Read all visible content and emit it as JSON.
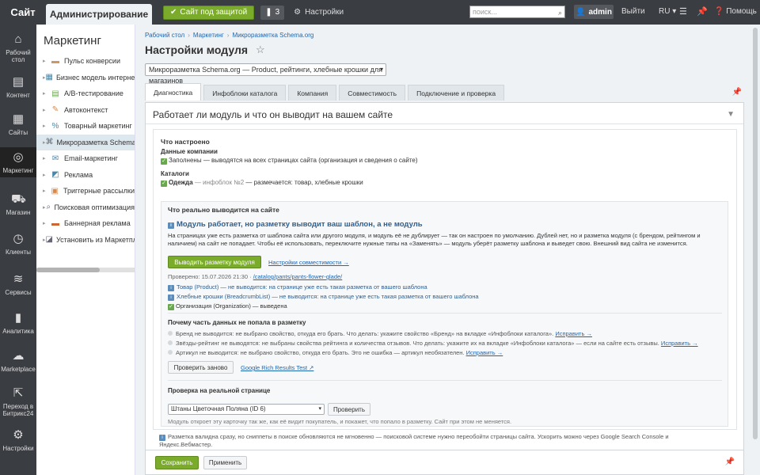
{
  "topbar": {
    "site_tab": "Сайт",
    "admin_tab": "Администрирование",
    "protect_label": "Сайт под защитой",
    "notif_count": "3",
    "settings_label": "Настройки",
    "search_placeholder": "поиск...",
    "user": "admin",
    "logout": "Выйти",
    "lang": "RU",
    "help": "Помощь"
  },
  "rail": [
    {
      "label": "Рабочий стол",
      "icon": "home-icon"
    },
    {
      "label": "Контент",
      "icon": "document-icon"
    },
    {
      "label": "Сайты",
      "icon": "calendar-icon"
    },
    {
      "label": "Маркетинг",
      "icon": "target-icon"
    },
    {
      "label": "Магазин",
      "icon": "cart-icon"
    },
    {
      "label": "Клиенты",
      "icon": "clock-icon"
    },
    {
      "label": "Сервисы",
      "icon": "layers-icon"
    },
    {
      "label": "Аналитика",
      "icon": "bar-chart-icon"
    },
    {
      "label": "Marketplace",
      "icon": "cloud-download-icon"
    },
    {
      "label": "Переход в Битрикс24",
      "icon": "arrow-out-icon"
    },
    {
      "label": "Настройки",
      "icon": "gear-icon"
    }
  ],
  "menu": {
    "title": "Маркетинг",
    "items": [
      "Пульс конверсии",
      "Бизнес модель интернет-м",
      "A/B-тестирование",
      "Автоконтекст",
      "Товарный маркетинг",
      "Микроразметка Schema.or",
      "Email-маркетинг",
      "Реклама",
      "Триггерные рассылки",
      "Поисковая оптимизация",
      "Баннерная реклама",
      "Установить из Маркетплей"
    ]
  },
  "breadcrumbs": [
    "Рабочий стол",
    "Маркетинг",
    "Микроразметка Schema.org"
  ],
  "page_title": "Настройки модуля",
  "module_select": "Микроразметка Schema.org — Product, рейтинги, хлебные крошки для магазинов",
  "tabs": [
    "Диагностика",
    "Инфоблоки каталога",
    "Компания",
    "Совместимость",
    "Подключение и проверка"
  ],
  "panel": {
    "title": "Работает ли модуль и что он выводит на вашем сайте",
    "configured_h": "Что настроено",
    "company_h": "Данные компании",
    "company_val": "Заполнены — выводятся на всех страницах сайта (организация и сведения о сайте)",
    "catalogs_h": "Каталоги",
    "catalog_name": "Одежда",
    "catalog_ib": " — инфоблок №2",
    "catalog_rest": " — размечается: товар, хлебные крошки"
  },
  "box": {
    "heading": "Что реально выводится на сайте",
    "subheading": "Модуль работает, но разметку выводит ваш шаблон, а не модуль",
    "para": "На страницах уже есть разметка от шаблона сайта или другого модуля, и модуль её не дублирует — так он настроен по умолчанию. Дублей нет, но и разметка модуля (с брендом, рейтингом и наличием) на сайт не попадает. Чтобы её использовать, переключите нужные типы на «Заменять» — модуль уберёт разметку шаблона и выведет свою. Внешний вид сайта не изменится.",
    "output_btn": "Выводить разметку модуля",
    "compat_link": "Настройки совместимости →",
    "checked_prefix": "Проверено: 15.07.2026 21:30 · ",
    "checked_url": "/catalog/pants/pants-flower-glade/",
    "line1_name": "Товар (Product)",
    "line1_rest": " — не выводится: на странице уже есть такая разметка от вашего шаблона",
    "line2_name": "Хлебные крошки (BreadcrumbList)",
    "line2_rest": " — не выводится: на странице уже есть такая разметка от вашего шаблона",
    "line3_name": "Организация (Organization)",
    "line3_rest": " — выведена",
    "why_h": "Почему часть данных не попала в разметку",
    "why1": "Бренд не выводится: не выбрано свойство, откуда его брать. Что делать: укажите свойство «Бренд» на вкладке «Инфоблоки каталога». ",
    "why2": "Звёзды-рейтинг не выводятся: не выбраны свойства рейтинга и количества отзывов. Что делать: укажите их на вкладке «Инфоблоки каталога» — если на сайте есть отзывы. ",
    "why3": "Артикул не выводится: не выбрано свойство, откуда его брать. Это не ошибка — артикул необязателен. ",
    "fix_link": "Исправить →",
    "recheck_btn": "Проверить заново",
    "google_link": "Google Rich Results Test ↗",
    "real_h": "Проверка на реальной странице",
    "page_select": "Штаны Цветочная Поляна (ID 6)",
    "check_btn": "Проверить",
    "real_note": "Модуль откроет эту карточку так же, как её видит покупатель, и покажет, что попало в разметку. Сайт при этом не меняется."
  },
  "foot_note": "Разметка валидна сразу, но сниппеты в поиске обновляются не мгновенно — поисковой системе нужно переобойти страницы сайта. Ускорить можно через Google Search Console и Яндекс.Вебмастер.",
  "bottom": {
    "save": "Сохранить",
    "apply": "Применить"
  }
}
